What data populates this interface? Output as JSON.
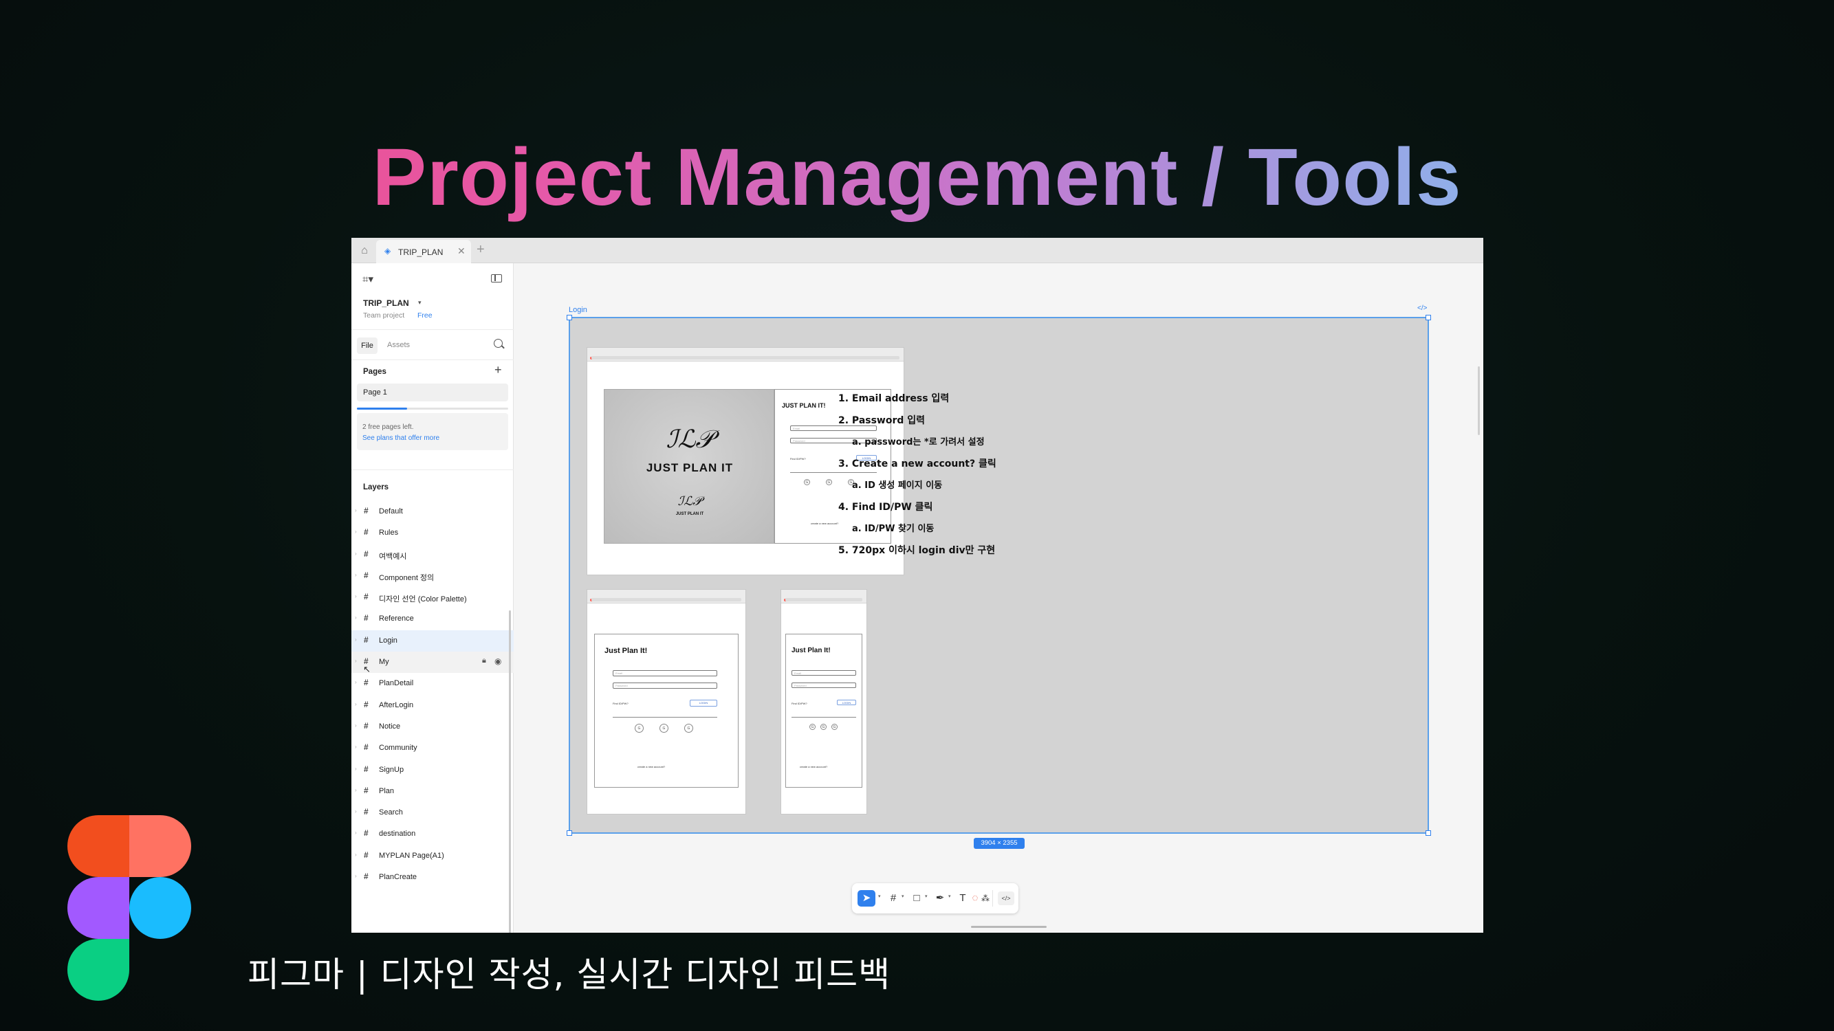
{
  "slide": {
    "title": "Project Management / Tools",
    "caption": "피그마 | 디자인 작성, 실시간 디자인 피드백"
  },
  "colors": {
    "title_gradient": [
      "#f2487f",
      "#c27ad0",
      "#78c2ef"
    ],
    "figma_red": "#f24e1e",
    "figma_orange": "#ff7262",
    "figma_purple": "#a259ff",
    "figma_blue": "#1abcfe",
    "figma_green": "#0acf83",
    "accent": "#2f80ed"
  },
  "app": {
    "tab": {
      "home_icon": "home-icon",
      "label": "TRIP_PLAN"
    },
    "sidebar": {
      "project_name": "TRIP_PLAN",
      "team_label": "Team project",
      "plan_label": "Free",
      "tab_file": "File",
      "tab_assets": "Assets",
      "pages_title": "Pages",
      "page_item": "Page 1",
      "pages_used_fraction": 0.33,
      "upsell_line1": "2 free pages left.",
      "upsell_line2": "See plans that offer more",
      "layers_title": "Layers",
      "layers": [
        "Default",
        "Rules",
        "여백예시",
        "Component 정의",
        "디자인 선언 (Color Palette)",
        "Reference",
        "Login",
        "My",
        "PlanDetail",
        "AfterLogin",
        "Notice",
        "Community",
        "SignUp",
        "Plan",
        "Search",
        "destination",
        "MYPLAN Page(A1)",
        "PlanCreate"
      ],
      "selected_layer": "Login",
      "hovered_layer": "My"
    },
    "canvas": {
      "frame_name": "Login",
      "frame_size": "3904 × 2355",
      "mock_desktop": {
        "brand": "JUST PLAN IT",
        "form_title": "JUST PLAN IT!",
        "email_placeholder": "Email",
        "password_placeholder": "Password",
        "find_link": "Find ID/PW?",
        "login_button": "LOGIN",
        "or_label": "or",
        "create_link": "create a new account?"
      },
      "mock_tablet": {
        "form_title": "Just Plan It!",
        "email_placeholder": "Email",
        "password_placeholder": "Password",
        "find_link": "Find ID/PW?",
        "login_button": "LOGIN",
        "create_link": "create a new account?"
      },
      "mock_mobile": {
        "form_title": "Just Plan It!",
        "email_placeholder": "Email",
        "password_placeholder": "Password",
        "find_link": "Find ID/PW?",
        "login_button": "LOGIN",
        "create_link": "create a new account?"
      },
      "notes": [
        "1. Email address 입력",
        "2. Password 입력",
        "a. password는 *로 가려서 설정",
        "3. Create a new account? 클릭",
        "a. ID 생성 페이지 이동",
        "4. Find ID/PW 클릭",
        "a. ID/PW 찾기 이동",
        "5. 720px 이하시 login div만 구현"
      ]
    },
    "toolbar": {
      "tools": [
        "move-tool",
        "frame-tool",
        "rectangle-tool",
        "pen-tool",
        "text-tool",
        "comment-tool",
        "actions-tool"
      ],
      "dev_mode_label": "</>"
    }
  }
}
